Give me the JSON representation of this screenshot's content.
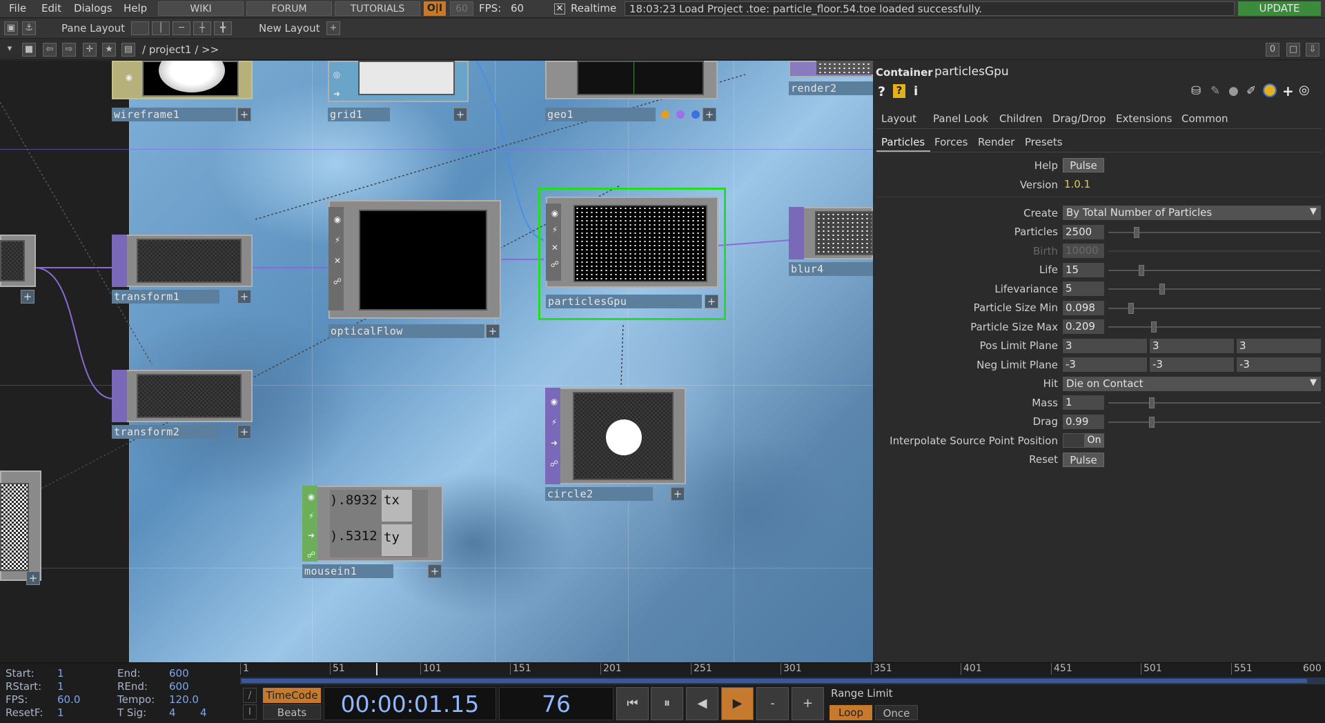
{
  "menubar": {
    "items": [
      "File",
      "Edit",
      "Dialogs",
      "Help"
    ],
    "links": [
      "WIKI",
      "FORUM",
      "TUTORIALS"
    ],
    "oi_label": "O|I",
    "fps_cap": "60",
    "fps_label": "FPS:",
    "fps_value": "60",
    "realtime_label": "Realtime",
    "status": "18:03:23 Load Project .toe: particle_floor.54.toe loaded successfully.",
    "update_label": "UPDATE"
  },
  "toolbar": {
    "pane_layout": "Pane Layout",
    "new_layout": "New Layout",
    "plus": "+"
  },
  "pathbar": {
    "path": "/ project1 / >>",
    "counter": "0"
  },
  "nodes": {
    "wireframe1": "wireframe1",
    "grid1": "grid1",
    "geo1": "geo1",
    "render2": "render2",
    "transform1": "transform1",
    "transform2": "transform2",
    "opticalFlow": "opticalFlow",
    "particlesGpu": "particlesGpu",
    "blur4": "blur4",
    "circle2": "circle2",
    "mousein1": "mousein1",
    "mousein_tx_value": ").8932",
    "mousein_tx": "tx",
    "mousein_ty_value": ").5312",
    "mousein_ty": "ty",
    "plus": "+"
  },
  "panel": {
    "type": "Container",
    "name": "particlesGpu",
    "tabs": [
      "Layout",
      "Panel",
      "Look",
      "Children",
      "Drag/Drop",
      "Extensions",
      "Common"
    ],
    "subtabs": [
      "Particles",
      "Forces",
      "Render",
      "Presets"
    ],
    "params": {
      "help_label": "Help",
      "help_btn": "Pulse",
      "version_label": "Version",
      "version_value": "1.0.1",
      "create_label": "Create",
      "create_value": "By Total Number of Particles",
      "particles_label": "Particles",
      "particles_value": "2500",
      "birth_label": "Birth",
      "birth_value": "10000",
      "life_label": "Life",
      "life_value": "15",
      "lifevariance_label": "Lifevariance",
      "lifevariance_value": "5",
      "sizemin_label": "Particle Size Min",
      "sizemin_value": "0.098",
      "sizemax_label": "Particle Size Max",
      "sizemax_value": "0.209",
      "poslimit_label": "Pos Limit Plane",
      "poslimit_values": [
        "3",
        "3",
        "3"
      ],
      "neglimit_label": "Neg Limit Plane",
      "neglimit_values": [
        "-3",
        "-3",
        "-3"
      ],
      "hit_label": "Hit",
      "hit_value": "Die on Contact",
      "mass_label": "Mass",
      "mass_value": "1",
      "drag_label": "Drag",
      "drag_value": "0.99",
      "interp_label": "Interpolate Source Point Position",
      "interp_value": "On",
      "reset_label": "Reset",
      "reset_btn": "Pulse"
    }
  },
  "timeline": {
    "start_label": "Start:",
    "start": "1",
    "rstart_label": "RStart:",
    "rstart": "1",
    "fps_label": "FPS:",
    "fps": "60.0",
    "resetf_label": "ResetF:",
    "resetf": "1",
    "end_label": "End:",
    "end": "600",
    "rend_label": "REnd:",
    "rend": "600",
    "tempo_label": "Tempo:",
    "tempo": "120.0",
    "tsig_label": "T Sig:",
    "tsig_a": "4",
    "tsig_b": "4",
    "ticks": [
      "1",
      "51",
      "101",
      "151",
      "201",
      "251",
      "301",
      "351",
      "401",
      "451",
      "501",
      "551",
      "600"
    ],
    "timecode_btn": "TimeCode",
    "beats_btn": "Beats",
    "timecode": "00:00:01.15",
    "frame": "76",
    "range_limit": "Range Limit",
    "loop": "Loop",
    "once": "Once",
    "minus": "-",
    "plus": "+"
  },
  "colors": {
    "accent_orange": "#c57a2d",
    "update_green": "#3c8a3c",
    "selection_green": "#22dd22",
    "timecode_blue": "#8fb8ff"
  }
}
